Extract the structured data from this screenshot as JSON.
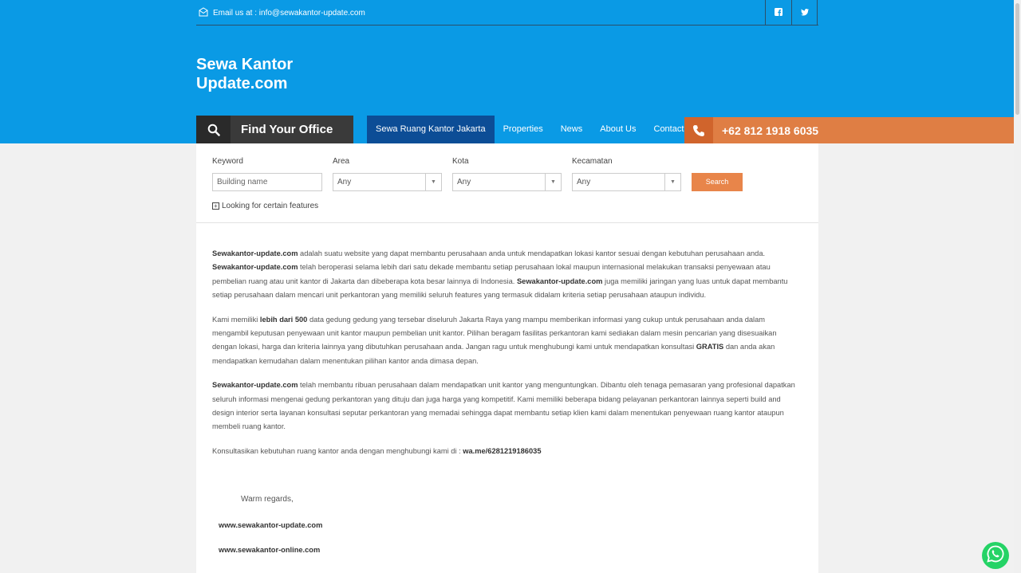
{
  "topbar": {
    "email_text": "Email us at : info@sewakantor-update.com"
  },
  "site": {
    "title_line1": "Sewa Kantor",
    "title_line2": "Update.com"
  },
  "find_office": {
    "label": "Find Your Office"
  },
  "nav": {
    "items": [
      {
        "label": "Sewa Ruang Kantor Jakarta",
        "active": true
      },
      {
        "label": "Properties"
      },
      {
        "label": "News"
      },
      {
        "label": "About Us"
      },
      {
        "label": "Contact us"
      }
    ]
  },
  "phone": {
    "number": "+62 812 1918 6035"
  },
  "search": {
    "keyword_label": "Keyword",
    "keyword_placeholder": "Building name",
    "area_label": "Area",
    "area_value": "Any",
    "kota_label": "Kota",
    "kota_value": "Any",
    "kecamatan_label": "Kecamatan",
    "kecamatan_value": "Any",
    "button_label": "Search",
    "features_label": "Looking for certain features"
  },
  "content": {
    "p1": [
      {
        "b": "Sewakantor-update.com"
      },
      {
        "t": " adalah suatu website yang dapat membantu perusahaan anda untuk mendapatkan lokasi kantor sesuai dengan kebutuhan perusahaan anda. "
      },
      {
        "b": "Sewakantor-update.com"
      },
      {
        "t": " telah beroperasi selama lebih dari satu dekade membantu setiap perusahaan lokal maupun internasional melakukan transaksi penyewaan atau pembelian ruang atau unit kantor di Jakarta dan dibeberapa kota besar lainnya di Indonesia. "
      },
      {
        "b": "Sewakantor-update.com"
      },
      {
        "t": " juga memiliki jaringan yang luas untuk dapat membantu setiap perusahaan dalam mencari unit perkantoran yang memiliki seluruh features yang termasuk didalam kriteria setiap perusahaan ataupun individu."
      }
    ],
    "p2": [
      {
        "t": "Kami memiliki "
      },
      {
        "b": "lebih dari 500"
      },
      {
        "t": " data gedung gedung yang tersebar diseluruh Jakarta Raya yang mampu memberikan informasi yang cukup untuk perusahaan anda dalam mengambil keputusan penyewaan unit kantor maupun pembelian unit kantor. Pilihan beragam fasilitas perkantoran kami sediakan dalam mesin pencarian yang disesuaikan dengan lokasi, harga dan kriteria lainnya yang dibutuhkan perusahaan anda. Jangan ragu untuk menghubungi kami untuk mendapatkan konsultasi "
      },
      {
        "b": "GRATIS"
      },
      {
        "t": " dan anda akan mendapatkan kemudahan dalam menentukan pilihan kantor anda dimasa depan."
      }
    ],
    "p3": [
      {
        "b": "Sewakantor-update.com"
      },
      {
        "t": " telah membantu ribuan perusahaan dalam mendapatkan unit kantor yang menguntungkan. Dibantu oleh tenaga pemasaran yang profesional dapatkan seluruh informasi mengenai gedung perkantoran yang dituju dan juga harga yang kompetitif. Kami memiliki beberapa bidang pelayanan perkantoran lainnya seperti build and design interior serta layanan konsultasi seputar perkantoran yang memadai sehingga dapat membantu setiap klien kami dalam menentukan penyewaan ruang kantor ataupun membeli ruang kantor."
      }
    ],
    "p4": [
      {
        "t": "Konsultasikan kebutuhan ruang kantor anda dengan menghubungi kami di :  "
      },
      {
        "b": "wa.me/6281219186035"
      }
    ],
    "regards": "Warm regards,",
    "link1": "www.sewakantor-update.com",
    "link2": "www.sewakantor-online.com"
  }
}
